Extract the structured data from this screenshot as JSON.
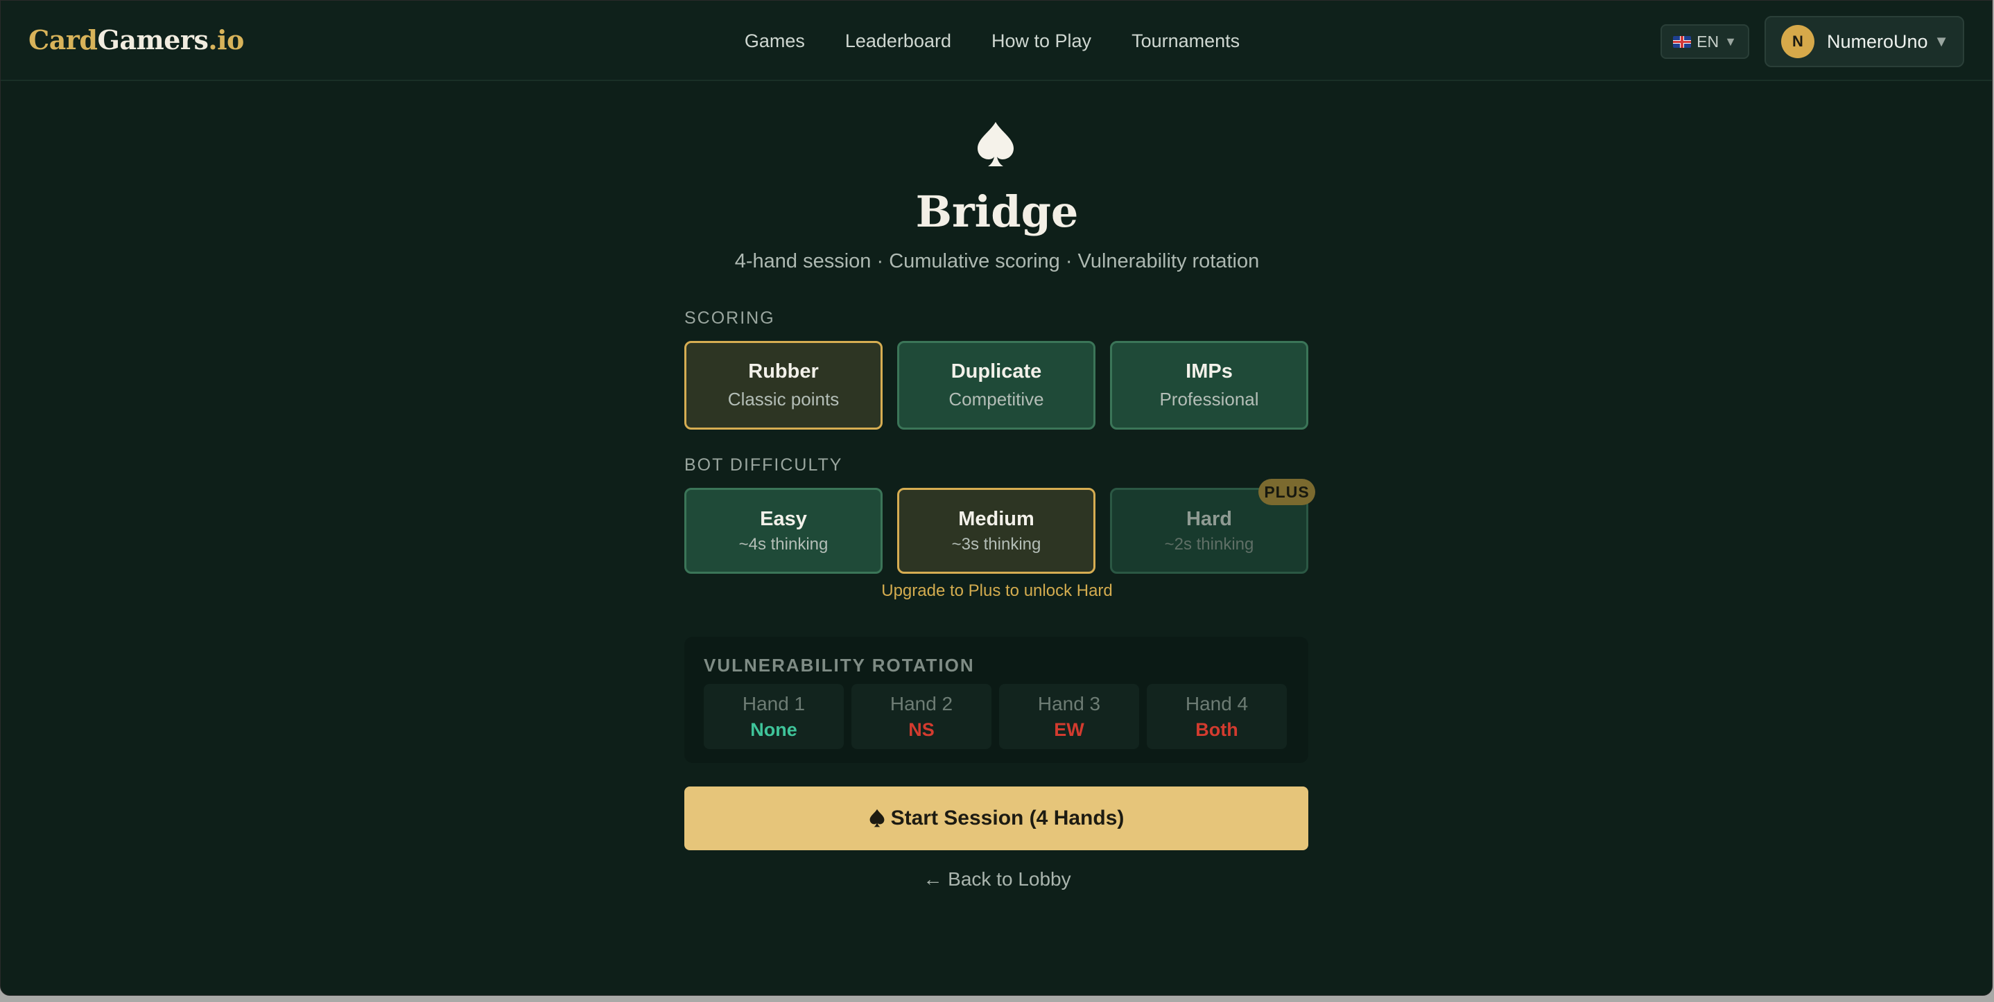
{
  "logo": {
    "part1": "Card",
    "part2": "Gamers",
    "part3": ".io"
  },
  "nav": [
    "Games",
    "Leaderboard",
    "How to Play",
    "Tournaments"
  ],
  "language": {
    "code": "EN"
  },
  "user": {
    "initial": "N",
    "name": "NumeroUno"
  },
  "game": {
    "title": "Bridge",
    "subtitle": "4-hand session · Cumulative scoring · Vulnerability rotation"
  },
  "scoring": {
    "label": "SCORING",
    "options": [
      {
        "name": "Rubber",
        "sub": "Classic points",
        "selected": true
      },
      {
        "name": "Duplicate",
        "sub": "Competitive",
        "selected": false
      },
      {
        "name": "IMPs",
        "sub": "Professional",
        "selected": false
      }
    ]
  },
  "difficulty": {
    "label": "BOT DIFFICULTY",
    "options": [
      {
        "name": "Easy",
        "sub": "~4s thinking",
        "selected": false
      },
      {
        "name": "Medium",
        "sub": "~3s thinking",
        "selected": true
      },
      {
        "name": "Hard",
        "sub": "~2s thinking",
        "locked": true
      }
    ],
    "badge": "PLUS",
    "upgrade_note": "Upgrade to Plus to unlock Hard"
  },
  "vulnerability": {
    "label": "VULNERABILITY ROTATION",
    "hands": [
      {
        "hand": "Hand 1",
        "value": "None",
        "color": "#3fc49a"
      },
      {
        "hand": "Hand 2",
        "value": "NS",
        "color": "#d33b2f"
      },
      {
        "hand": "Hand 3",
        "value": "EW",
        "color": "#d33b2f"
      },
      {
        "hand": "Hand 4",
        "value": "Both",
        "color": "#d33b2f"
      }
    ]
  },
  "actions": {
    "start_label": "Start Session (4 Hands)",
    "back_label": "← Back to Lobby"
  },
  "colors": {
    "accent": "#e6c57a",
    "background": "#0e1f19"
  }
}
